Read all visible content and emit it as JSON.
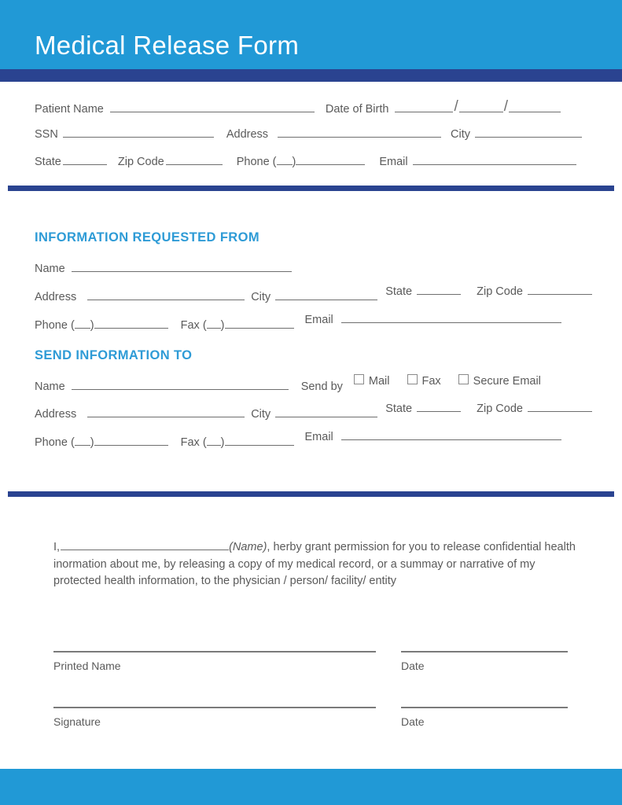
{
  "document": {
    "title": "Medical Release Form"
  },
  "colors": {
    "header_blue": "#2199D6",
    "navy": "#2A4390",
    "heading_blue": "#2E9BD6",
    "rule_gray": "#6E6E6E",
    "text_gray": "#5A5A5A"
  },
  "patient_section": {
    "fields": {
      "patient_name": "Patient Name",
      "date_of_birth": "Date of Birth",
      "ssn": "SSN",
      "address": "Address",
      "city": "City",
      "state": "State",
      "zip_code": "Zip Code",
      "phone": "Phone (",
      "phone_close": ")",
      "email": "Email"
    },
    "dob_separator": "/"
  },
  "requested_from": {
    "heading": "INFORMATION REQUESTED FROM",
    "fields": {
      "name": "Name",
      "address": "Address",
      "city": "City",
      "state": "State",
      "zip_code": "Zip Code",
      "phone": "Phone (",
      "phone_close": ")",
      "fax": "Fax (",
      "fax_close": ")",
      "email": "Email"
    }
  },
  "send_to": {
    "heading": "SEND INFORMATION TO",
    "fields": {
      "name": "Name",
      "address": "Address",
      "city": "City",
      "state": "State",
      "zip_code": "Zip Code",
      "phone": "Phone (",
      "phone_close": ")",
      "fax": "Fax (",
      "fax_close": ")",
      "email": "Email"
    },
    "send_by_label": "Send by",
    "send_by_options": [
      {
        "label": "Mail",
        "checked": false
      },
      {
        "label": "Fax",
        "checked": false
      },
      {
        "label": "Secure Email",
        "checked": false
      }
    ]
  },
  "consent": {
    "lead": "I,",
    "name_hint": "(Name)",
    "text_after_name": ", herby grant permission for you to release confidential health inormation about me, by releasing a copy of my medical record, or a summay or narrative of my protected health information, to the physician / person/ facility/ entity"
  },
  "signature_block": {
    "printed_name": "Printed Name",
    "signature": "Signature",
    "date_left": "Date",
    "date_right": "Date"
  }
}
